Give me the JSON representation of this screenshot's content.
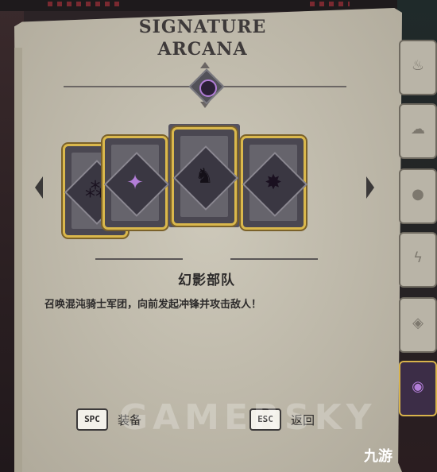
{
  "title": {
    "line1": "SIGNATURE",
    "line2": "ARCANA"
  },
  "cards": [
    {
      "id": "card-1",
      "icon": "sparks-icon",
      "glyph": "⁂",
      "selected": true
    },
    {
      "id": "card-2",
      "icon": "crystal-blade-icon",
      "glyph": "✦",
      "selected": true
    },
    {
      "id": "card-3",
      "icon": "horned-helmet-icon",
      "glyph": "♞",
      "selected": true
    },
    {
      "id": "card-4",
      "icon": "shadow-burst-icon",
      "glyph": "✸",
      "selected": true
    }
  ],
  "selected": {
    "name": "幻影部队",
    "description": "召唤混沌骑士军团，向前发起冲锋并攻击敌人！"
  },
  "controls": {
    "equip_key": "SPC",
    "equip_label": "装备",
    "back_key": "ESC",
    "back_label": "返回"
  },
  "side_tabs": [
    {
      "icon": "flame-icon",
      "glyph": "♨",
      "active": false
    },
    {
      "icon": "wind-icon",
      "glyph": "☁",
      "active": false
    },
    {
      "icon": "orb-icon",
      "glyph": "●",
      "active": false
    },
    {
      "icon": "lightning-icon",
      "glyph": "ϟ",
      "active": false
    },
    {
      "icon": "water-icon",
      "glyph": "◈",
      "active": false
    },
    {
      "icon": "chaos-icon",
      "glyph": "◉",
      "active": true
    }
  ],
  "watermark": "GAMERSKY",
  "logo": "九游",
  "colors": {
    "gold": "#dab84c",
    "parchment": "#c9c4b4",
    "chaos": "#b37ed8"
  }
}
